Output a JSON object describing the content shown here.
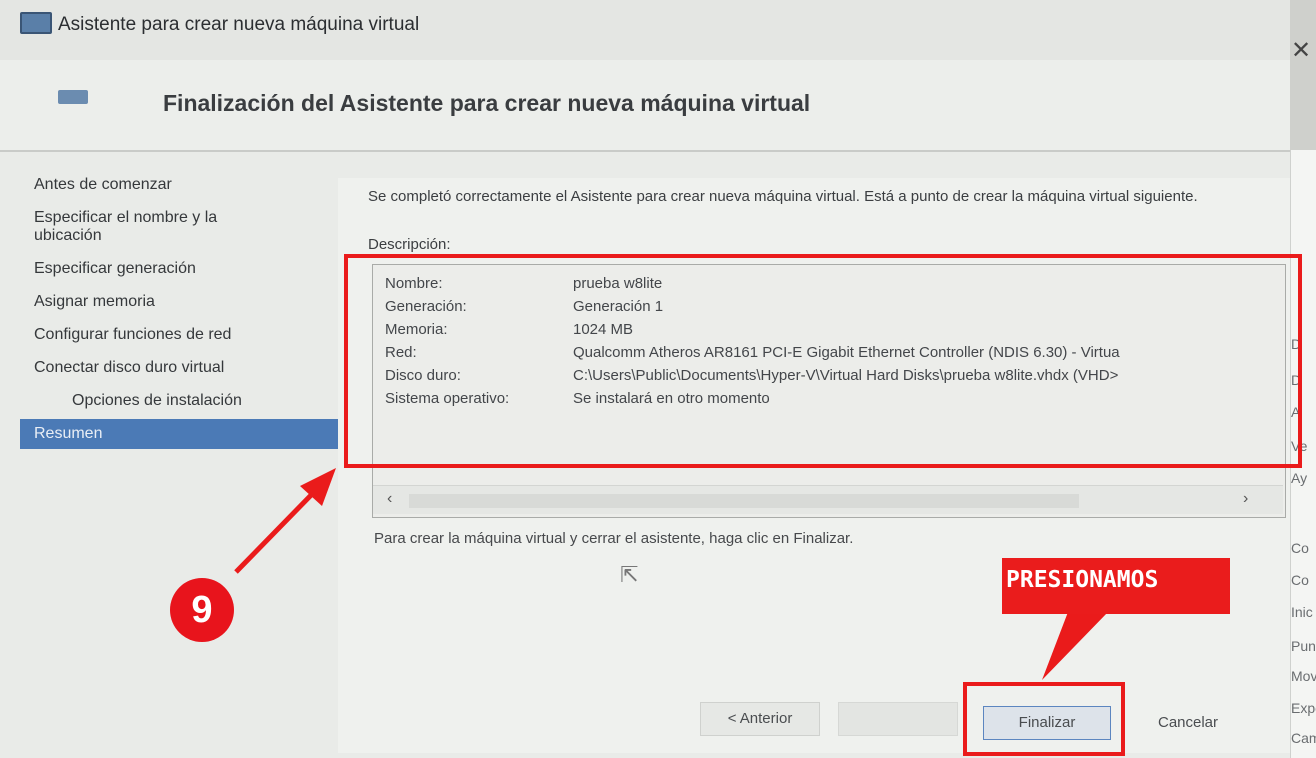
{
  "window": {
    "title": "Asistente para crear nueva máquina virtual",
    "close_icon": "close-icon"
  },
  "header": {
    "title": "Finalización del Asistente para crear nueva máquina virtual"
  },
  "sidebar": {
    "items": [
      {
        "label": "Antes de comenzar"
      },
      {
        "label": "Especificar el nombre y la ubicación"
      },
      {
        "label": "Especificar generación"
      },
      {
        "label": "Asignar memoria"
      },
      {
        "label": "Configurar funciones de red"
      },
      {
        "label": "Conectar disco duro virtual"
      },
      {
        "label": "Opciones de instalación"
      },
      {
        "label": "Resumen"
      }
    ]
  },
  "main": {
    "intro": "Se completó correctamente el Asistente para crear nueva máquina virtual. Está a punto de crear la máquina virtual siguiente.",
    "description_label": "Descripción:",
    "rows": [
      {
        "key": "Nombre:",
        "value": "prueba w8lite"
      },
      {
        "key": "Generación:",
        "value": "Generación 1"
      },
      {
        "key": "Memoria:",
        "value": "1024 MB"
      },
      {
        "key": "Red:",
        "value": "Qualcomm Atheros AR8161 PCI-E Gigabit Ethernet Controller (NDIS 6.30) - Virtua"
      },
      {
        "key": "Disco duro:",
        "value": "C:\\Users\\Public\\Documents\\Hyper-V\\Virtual Hard Disks\\prueba w8lite.vhdx (VHD>"
      },
      {
        "key": "Sistema operativo:",
        "value": "Se instalará en otro momento"
      }
    ],
    "finish_hint": "Para crear la máquina virtual y cerrar el asistente, haga clic en Finalizar."
  },
  "buttons": {
    "previous": "< Anterior",
    "next": "",
    "finish": "Finalizar",
    "cancel": "Cancelar"
  },
  "side_panel": {
    "items": [
      "D",
      "D",
      "A",
      "Ve",
      "Ay",
      "Co",
      "Co",
      "Inic",
      "Pun",
      "Mov",
      "Expo",
      "Cam"
    ]
  },
  "annotations": {
    "step_number": "9",
    "action_label": "PRESIONAMOS",
    "color": "#ea1b1b"
  },
  "colors": {
    "accent": "#4b7ab6",
    "window_bg": "#e9ebe8"
  }
}
